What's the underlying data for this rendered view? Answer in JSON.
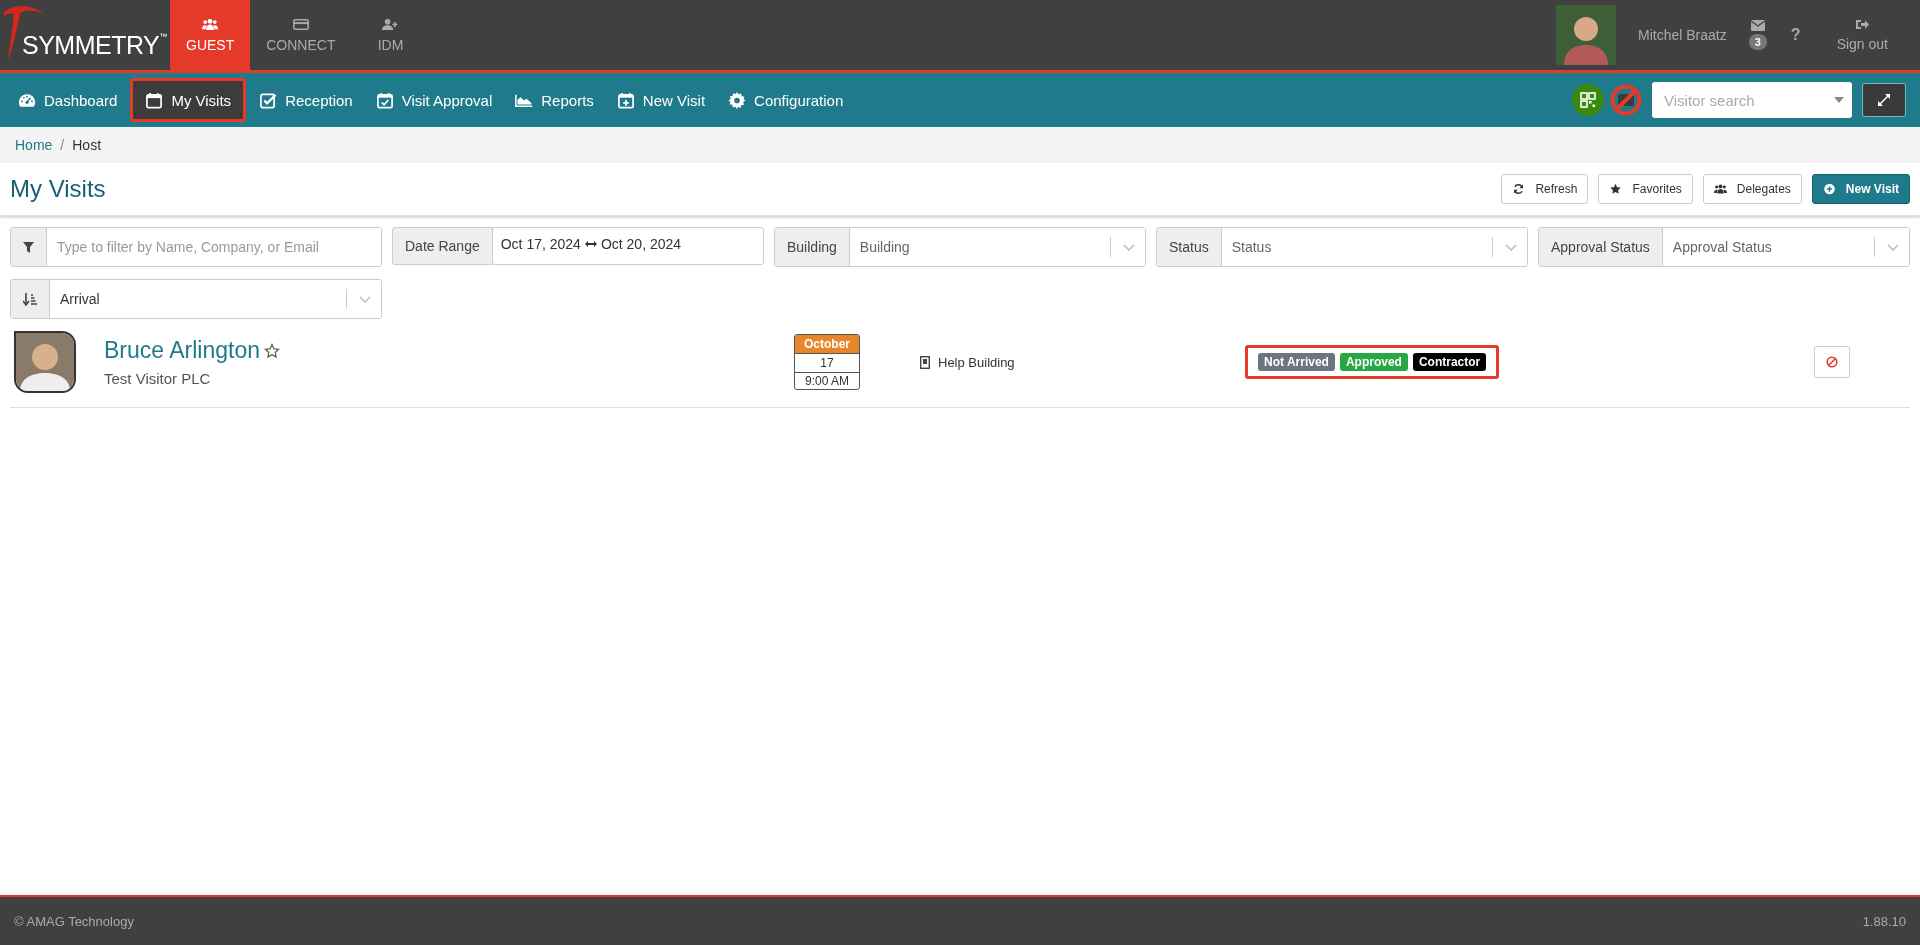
{
  "top_bar": {
    "logo": "SYMMETRY",
    "logo_mark": "™",
    "apps": [
      {
        "label": "GUEST",
        "selected": true
      },
      {
        "label": "CONNECT",
        "selected": false
      },
      {
        "label": "IDM",
        "selected": false
      }
    ],
    "user_name": "Mitchel Braatz",
    "messages_count": "3",
    "help": "?",
    "sign_out": "Sign out"
  },
  "nav": {
    "items": [
      {
        "label": "Dashboard",
        "selected": false
      },
      {
        "label": "My Visits",
        "selected": true
      },
      {
        "label": "Reception",
        "selected": false
      },
      {
        "label": "Visit Approval",
        "selected": false
      },
      {
        "label": "Reports",
        "selected": false
      },
      {
        "label": "New Visit",
        "selected": false
      },
      {
        "label": "Configuration",
        "selected": false
      }
    ],
    "visitor_search": {
      "placeholder": "Visitor search"
    }
  },
  "breadcrumb": {
    "items": [
      "Home",
      "Host"
    ],
    "separator": "/"
  },
  "page_title": "My Visits",
  "actions": [
    {
      "label": "Refresh",
      "kind": "plain"
    },
    {
      "label": "Favorites",
      "kind": "plain"
    },
    {
      "label": "Delegates",
      "kind": "plain"
    },
    {
      "label": "New Visit",
      "kind": "primary"
    }
  ],
  "filters": {
    "search": {
      "placeholder": "Type to filter by Name, Company, or Email"
    },
    "date_range": {
      "label": "Date Range",
      "from": "Oct 17, 2024",
      "to": "Oct 20, 2024"
    },
    "selects": [
      {
        "label": "Building",
        "placeholder": "Building"
      },
      {
        "label": "Status",
        "placeholder": "Status"
      },
      {
        "label": "Approval Status",
        "placeholder": "Approval Status"
      }
    ],
    "sort": {
      "value": "Arrival"
    }
  },
  "visits": [
    {
      "name": "Bruce Arlington",
      "favorite": false,
      "company": "Test Visitor PLC",
      "month": "October",
      "day": "17",
      "time": "9:00 AM",
      "building": "Help Building",
      "tags_highlighted": true,
      "tags": [
        {
          "label": "Not Arrived",
          "color": "#6c757d"
        },
        {
          "label": "Approved",
          "color": "#28a745"
        },
        {
          "label": "Contractor",
          "color": "#000000"
        }
      ]
    }
  ],
  "footer": {
    "copyright": "© AMAG Technology",
    "version": "1.88.10"
  }
}
